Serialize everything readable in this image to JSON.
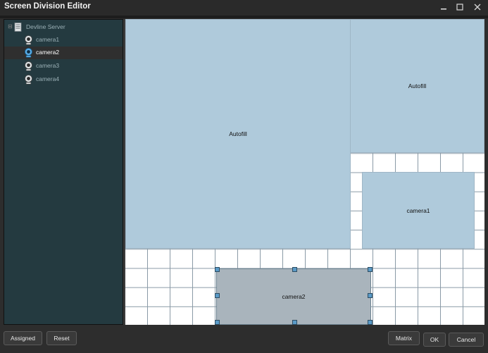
{
  "window": {
    "title": "Screen Division Editor",
    "minimize_icon": "minimize-icon",
    "maximize_icon": "maximize-icon",
    "close_icon": "close-icon"
  },
  "tree": {
    "server": {
      "label": "Devline Server",
      "icon": "server-icon"
    },
    "cameras": [
      {
        "label": "camera1",
        "icon": "webcam-icon",
        "selected": false
      },
      {
        "label": "camera2",
        "icon": "webcam-icon",
        "selected": true
      },
      {
        "label": "camera3",
        "icon": "webcam-icon",
        "selected": false
      },
      {
        "label": "camera4",
        "icon": "webcam-icon",
        "selected": false
      }
    ]
  },
  "layout": {
    "regions": [
      {
        "label": "Autofill"
      },
      {
        "label": "Autofill"
      },
      {
        "label": "camera1"
      },
      {
        "label": "camera2"
      }
    ]
  },
  "buttons": {
    "assigned": "Assigned",
    "reset": "Reset",
    "matrix": "Matrix",
    "ok": "OK",
    "cancel": "Cancel"
  },
  "colors": {
    "tree_background": "#243a40",
    "region_fill": "#afcadb",
    "selected_region_fill": "#a9b4bc",
    "handle": "#5a9ac7"
  }
}
